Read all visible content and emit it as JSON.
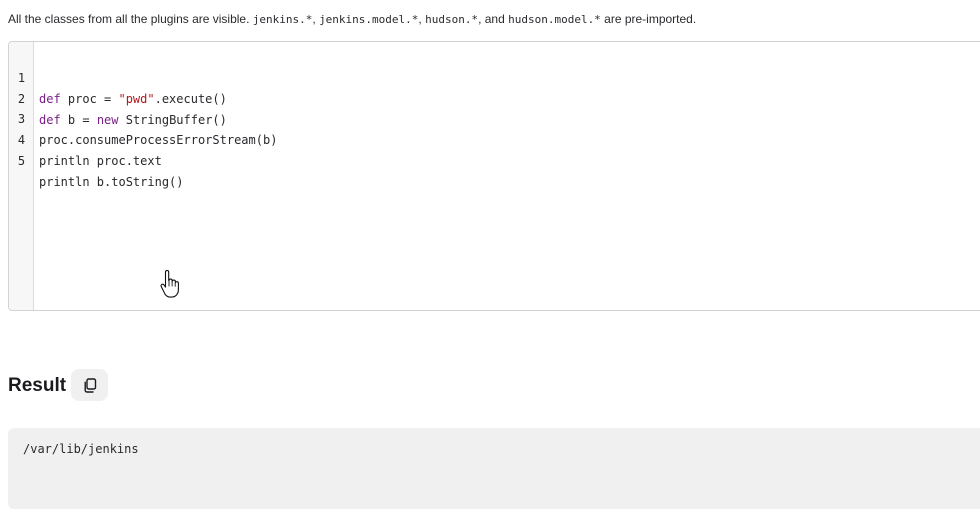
{
  "intro": {
    "prefix": "All the classes from all the plugins are visible. ",
    "pkg1": "jenkins.*",
    "sep1": ", ",
    "pkg2": "jenkins.model.*",
    "sep2": ", ",
    "pkg3": "hudson.*",
    "sep3": ", and ",
    "pkg4": "hudson.model.*",
    "suffix": " are pre-imported."
  },
  "editor": {
    "lines": [
      {
        "number": "1",
        "kw": "def",
        "pre": " proc = ",
        "str": "\"pwd\"",
        "post": ".execute()"
      },
      {
        "number": "2",
        "kw": "def",
        "pre": " b = ",
        "kw2": "new",
        "post": " StringBuffer()"
      },
      {
        "number": "3",
        "text": "proc.consumeProcessErrorStream(b)"
      },
      {
        "number": "4",
        "text": "println proc.text"
      },
      {
        "number": "5",
        "text": "println b.toString()"
      }
    ]
  },
  "result": {
    "title": "Result",
    "copy_icon": "copy-icon",
    "output": "/var/lib/jenkins"
  }
}
